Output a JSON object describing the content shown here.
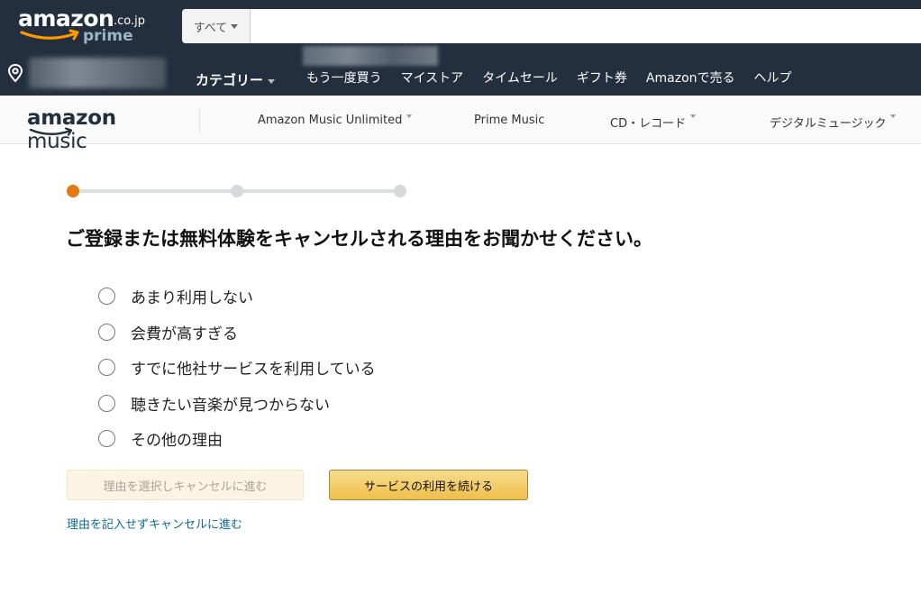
{
  "header": {
    "logo_main": "amazon",
    "logo_tld": ".co.jp",
    "logo_sub": "prime",
    "search": {
      "category": "すべて",
      "query": ""
    },
    "category_menu": "カテゴリー",
    "nav_links": [
      "もう一度買う",
      "マイストア",
      "タイムセール",
      "ギフト券",
      "Amazonで売る",
      "ヘルプ"
    ]
  },
  "music_header": {
    "logo_amazon": "amazon",
    "logo_music": "music",
    "nav": [
      {
        "label": "Amazon Music Unlimited",
        "has_caret": true
      },
      {
        "label": "Prime Music",
        "has_caret": false
      },
      {
        "label": "CD・レコード",
        "has_caret": true
      },
      {
        "label": "デジタルミュージック",
        "has_caret": true
      }
    ]
  },
  "stepper": {
    "current_step": 1,
    "total_steps": 3,
    "active_color": "#e47911"
  },
  "question": "ご登録または無料体験をキャンセルされる理由をお聞かせください。",
  "options": [
    "あまり利用しない",
    "会費が高すぎる",
    "すでに他社サービスを利用している",
    "聴きたい音楽が見つからない",
    "その他の理由"
  ],
  "buttons": {
    "select_reason_cancel": "理由を選択しキャンセルに進む",
    "continue_service": "サービスの利用を続ける"
  },
  "skip_link": "理由を記入せずキャンセルに進む",
  "colors": {
    "header_bg": "#232f3e",
    "accent": "#e47911",
    "link": "#0f6a96"
  }
}
